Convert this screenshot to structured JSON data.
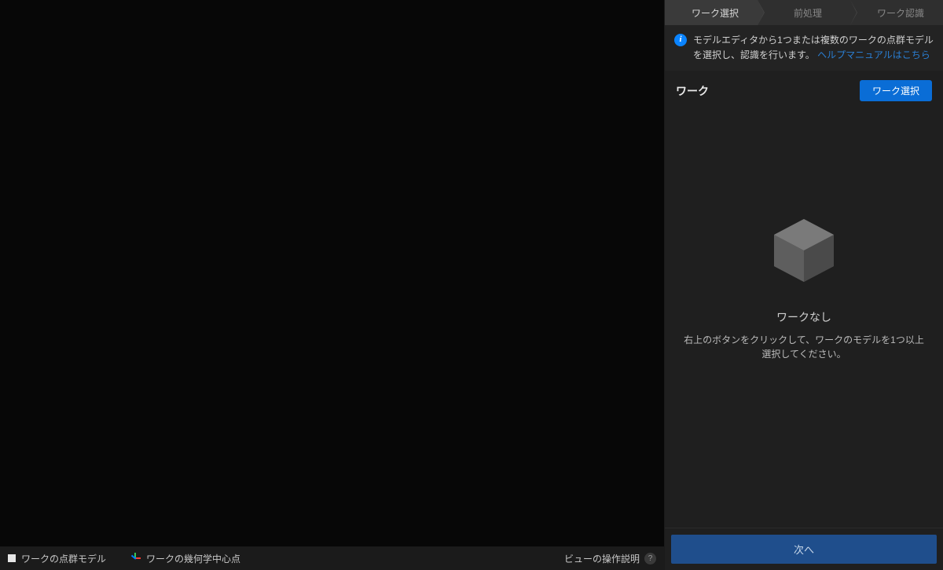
{
  "breadcrumb": {
    "items": [
      {
        "label": "ワーク選択",
        "active": true
      },
      {
        "label": "前処理",
        "active": false
      },
      {
        "label": "ワーク認識",
        "active": false
      }
    ]
  },
  "info": {
    "text": "モデルエディタから1つまたは複数のワークの点群モデルを選択し、認識を行います。",
    "link": "ヘルプマニュアルはこちら"
  },
  "section": {
    "title": "ワーク",
    "selectButton": "ワーク選択"
  },
  "empty": {
    "title": "ワークなし",
    "desc": "右上のボタンをクリックして、ワークのモデルを1つ以上選択してください。"
  },
  "footer": {
    "nextButton": "次へ"
  },
  "viewportFooter": {
    "legend1": "ワークの点群モデル",
    "legend2": "ワークの幾何学中心点",
    "help": "ビューの操作説明",
    "helpSymbol": "?"
  }
}
